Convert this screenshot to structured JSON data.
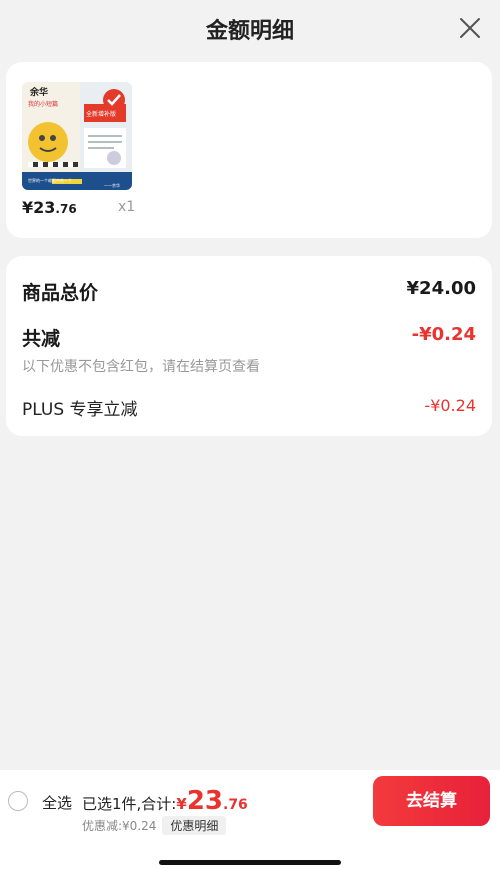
{
  "header": {
    "title": "金额明细",
    "close_icon": "close-icon"
  },
  "product": {
    "cover": {
      "author": "余华",
      "title_line": "我的小短篇",
      "badge": "全新增补版",
      "promo_line": "世界的一个缩影中的一个",
      "quote": "——余华"
    },
    "price_main": "¥23",
    "price_decimal": ".76",
    "quantity": "x1"
  },
  "summary": {
    "total_label": "商品总价",
    "total_value": "¥24.00",
    "reduce_label": "共减",
    "reduce_value": "-¥0.24",
    "note": "以下优惠不包含红包，请在结算页查看",
    "plus_label": "PLUS 专享立减",
    "plus_value": "-¥0.24"
  },
  "bottom_bar": {
    "select_all": "全选",
    "selected_text": "已选1件,合计:",
    "total_symbol": "¥",
    "total_int": "23",
    "total_dec": ".76",
    "discount_text": "优惠减:¥0.24",
    "detail_chip": "优惠明细",
    "checkout": "去结算"
  },
  "colors": {
    "accent_red": "#e9332f",
    "button_gradient_start": "#f33a3c",
    "button_gradient_end": "#e8213a",
    "page_bg": "#f2f2f2"
  }
}
